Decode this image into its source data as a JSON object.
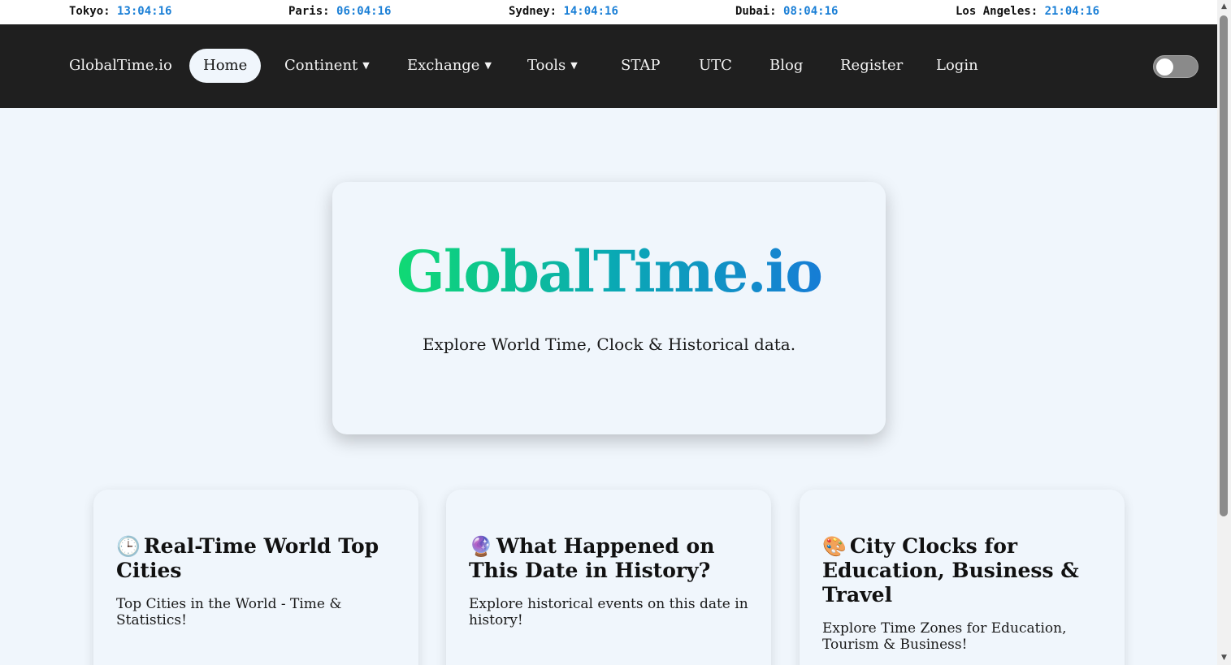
{
  "clocks": [
    {
      "city": "Tokyo:",
      "time": "13:04:16"
    },
    {
      "city": "Paris:",
      "time": "06:04:16"
    },
    {
      "city": "Sydney:",
      "time": "14:04:16"
    },
    {
      "city": "Dubai:",
      "time": "08:04:16"
    },
    {
      "city": "Los Angeles:",
      "time": "21:04:16"
    }
  ],
  "nav": {
    "brand": "GlobalTime.io",
    "home": "Home",
    "continent": "Continent",
    "exchange": "Exchange",
    "tools": "Tools",
    "stap": "STAP",
    "utc": "UTC",
    "blog": "Blog",
    "register": "Register",
    "login": "Login",
    "caret": "▼"
  },
  "hero": {
    "title": "GlobalTime.io",
    "subtitle": "Explore World Time, Clock & Historical data."
  },
  "cards": [
    {
      "icon": "🕒",
      "title": "Real-Time World Top Cities",
      "desc": "Top Cities in the World - Time & Statistics!"
    },
    {
      "icon": "🔮",
      "title": "What Happened on This Date in History?",
      "desc": "Explore historical events on this date in history!"
    },
    {
      "icon": "🎨",
      "title": "City Clocks for Education, Business & Travel",
      "desc": "Explore Time Zones for Education, Tourism & Business!"
    }
  ],
  "colors": {
    "navbar": "#1f1f1f",
    "background": "#f0f6fc",
    "clock_time": "#1a7fd6",
    "gradient_start": "#12e860",
    "gradient_end": "#1a6fe0"
  }
}
